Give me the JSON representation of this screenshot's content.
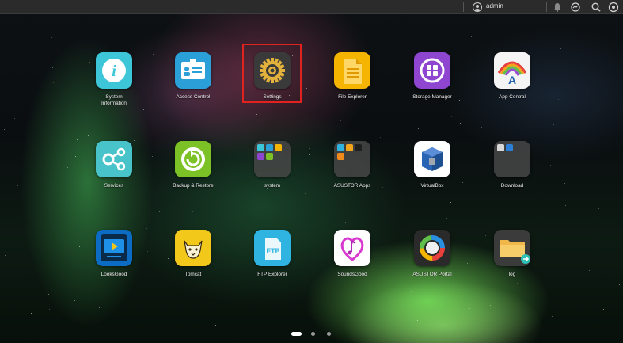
{
  "topbar": {
    "username": "admin",
    "icons": [
      "user-icon",
      "bell-icon",
      "activity-monitor-icon",
      "search-icon",
      "settings-gear-icon"
    ]
  },
  "apps": [
    {
      "name": "system-information",
      "label": "System Information",
      "icon": "info-icon",
      "color": "#3cc6d8"
    },
    {
      "name": "access-control",
      "label": "Access Control",
      "icon": "id-card-icon",
      "color": "#2b9fd8"
    },
    {
      "name": "settings",
      "label": "Settings",
      "icon": "gear-icon",
      "color": "#3a3a3a"
    },
    {
      "name": "file-explorer",
      "label": "File Explorer",
      "icon": "file-icon",
      "color": "#f5b400"
    },
    {
      "name": "storage-manager",
      "label": "Storage Manager",
      "icon": "storage-icon",
      "color": "#8e45cf"
    },
    {
      "name": "app-central",
      "label": "App Central",
      "icon": "app-central-icon",
      "color": "#f4f4f4"
    },
    {
      "name": "services",
      "label": "Services",
      "icon": "services-icon",
      "color": "#48c3c9"
    },
    {
      "name": "backup-restore",
      "label": "Backup & Restore",
      "icon": "backup-icon",
      "color": "#7cc226"
    },
    {
      "name": "system-folder",
      "label": "system",
      "icon": "folder-icon",
      "color": "#464646"
    },
    {
      "name": "asustor-apps-folder",
      "label": "ASUSTOR Apps",
      "icon": "folder-icon",
      "color": "#464646"
    },
    {
      "name": "virtualbox",
      "label": "VirtualBox",
      "icon": "virtualbox-icon",
      "color": "#ffffff"
    },
    {
      "name": "download-folder",
      "label": "Download",
      "icon": "folder-icon",
      "color": "#464646"
    },
    {
      "name": "lookscood",
      "label": "LooksGood",
      "icon": "monitor-icon",
      "color": "#0c6cc4"
    },
    {
      "name": "tomcat",
      "label": "Tomcat",
      "icon": "tomcat-icon",
      "color": "#f2c91a"
    },
    {
      "name": "ftp-explorer",
      "label": "FTP Explorer",
      "icon": "ftp-icon",
      "color": "#2fb3e0"
    },
    {
      "name": "soundsgood",
      "label": "SoundsGood",
      "icon": "music-note-icon",
      "color": "#ffffff"
    },
    {
      "name": "asustor-portal",
      "label": "ASUSTOR Portal",
      "icon": "portal-ring-icon",
      "color": "#2a2a2a"
    },
    {
      "name": "log-folder",
      "label": "log",
      "icon": "folder-shortcut-icon",
      "color": "#3b3b3b"
    }
  ],
  "pager": {
    "pages": 3,
    "current": 1
  }
}
